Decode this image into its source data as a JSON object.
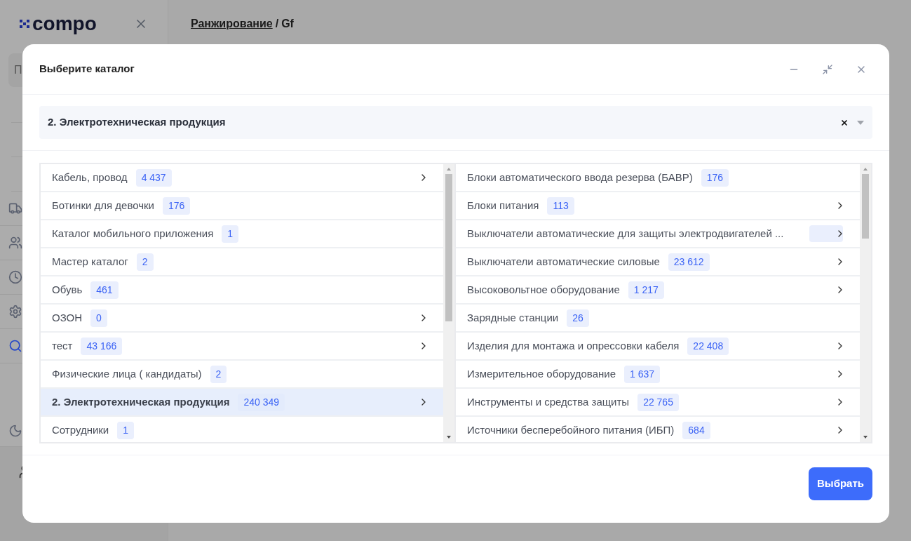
{
  "app": {
    "logo": "compo",
    "breadcrumb": {
      "link": "Ранжирование",
      "separator": "/",
      "current": "Gf"
    },
    "sidebar_button": "П",
    "nav": [
      {
        "kind": "truck",
        "selected": false
      },
      {
        "kind": "users",
        "selected": false
      },
      {
        "kind": "clock",
        "selected": false
      },
      {
        "kind": "settings",
        "selected": false
      },
      {
        "kind": "search",
        "selected": true
      }
    ]
  },
  "dialog": {
    "title": "Выберите каталог",
    "select": {
      "value": "2. Электротехническая продукция"
    },
    "left_list": [
      {
        "name": "Кабель, провод",
        "count": "4 437",
        "has_children": true,
        "selected": false
      },
      {
        "name": "Ботинки для девочки",
        "count": "176",
        "has_children": false,
        "selected": false
      },
      {
        "name": "Каталог мобильного приложения",
        "count": "1",
        "has_children": false,
        "selected": false
      },
      {
        "name": "Мастер каталог",
        "count": "2",
        "has_children": false,
        "selected": false
      },
      {
        "name": "Обувь",
        "count": "461",
        "has_children": false,
        "selected": false
      },
      {
        "name": "ОЗОН",
        "count": "0",
        "has_children": true,
        "selected": false
      },
      {
        "name": "тест",
        "count": "43 166",
        "has_children": true,
        "selected": false
      },
      {
        "name": "Физические лица ( кандидаты)",
        "count": "2",
        "has_children": false,
        "selected": false
      },
      {
        "name": "2. Электротехническая продукция",
        "count": "240 349",
        "has_children": true,
        "selected": true
      },
      {
        "name": "Сотрудники",
        "count": "1",
        "has_children": false,
        "selected": false
      }
    ],
    "right_list": [
      {
        "name": "Блоки автоматического ввода резерва (БАВР)",
        "count": "176",
        "has_children": false
      },
      {
        "name": "Блоки питания",
        "count": "113",
        "has_children": true
      },
      {
        "name": "Выключатели автоматические для защиты электродвигателей ...",
        "has_children": true
      },
      {
        "name": "Выключатели автоматические силовые",
        "count": "23 612",
        "has_children": true
      },
      {
        "name": "Высоковольтное оборудование",
        "count": "1 217",
        "has_children": true
      },
      {
        "name": "Зарядные станции",
        "count": "26",
        "has_children": false
      },
      {
        "name": "Изделия для монтажа и опрессовки кабеля",
        "count": "22 408",
        "has_children": true
      },
      {
        "name": "Измерительное оборудование",
        "count": "1 637",
        "has_children": true
      },
      {
        "name": "Инструменты и средства защиты",
        "count": "22 765",
        "has_children": true
      },
      {
        "name": "Источники бесперебойного питания (ИБП)",
        "count": "684",
        "has_children": true
      }
    ],
    "submit_button": "Выбрать"
  }
}
